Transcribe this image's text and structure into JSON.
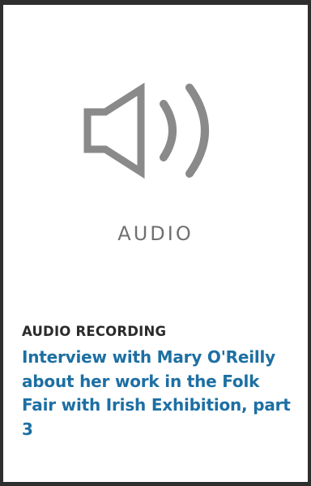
{
  "thumbnail": {
    "icon": "speaker-volume-icon",
    "media_label": "AUDIO"
  },
  "item": {
    "type_label": "AUDIO RECORDING",
    "title": "Interview with Mary O'Reilly about her work in the Folk Fair with Irish Exhibition, part 3"
  },
  "colors": {
    "icon": "#8a8a8a",
    "media_label": "#707070",
    "type_label": "#2b2b2b",
    "title_link": "#1d6fa3",
    "frame": "#2e2e2e"
  }
}
